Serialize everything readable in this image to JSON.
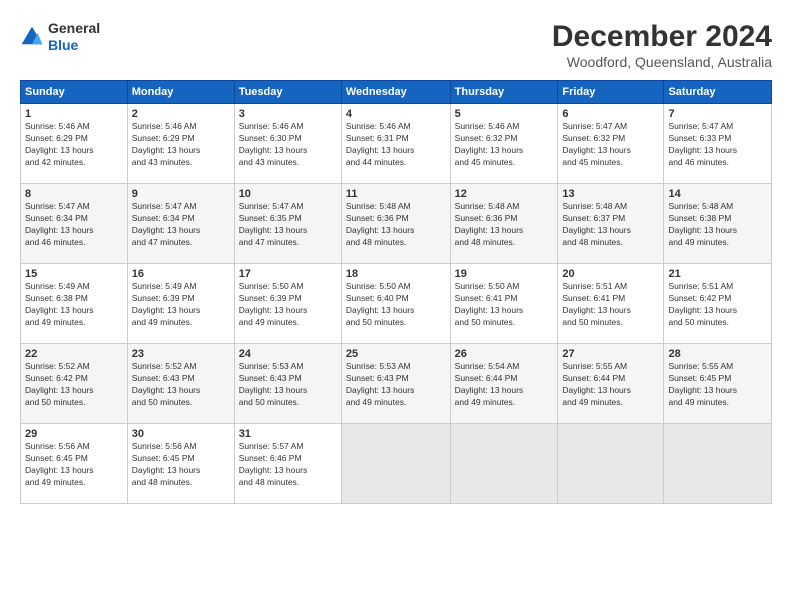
{
  "header": {
    "logo": {
      "line1": "General",
      "line2": "Blue"
    },
    "title": "December 2024",
    "subtitle": "Woodford, Queensland, Australia"
  },
  "calendar": {
    "days_of_week": [
      "Sunday",
      "Monday",
      "Tuesday",
      "Wednesday",
      "Thursday",
      "Friday",
      "Saturday"
    ],
    "weeks": [
      [
        null,
        null,
        null,
        null,
        null,
        null,
        null
      ]
    ],
    "cells": [
      {
        "day": null,
        "info": ""
      },
      {
        "day": null,
        "info": ""
      },
      {
        "day": null,
        "info": ""
      },
      {
        "day": null,
        "info": ""
      },
      {
        "day": null,
        "info": ""
      },
      {
        "day": null,
        "info": ""
      },
      {
        "day": null,
        "info": ""
      }
    ],
    "rows": [
      [
        {
          "day": 1,
          "sunrise": "5:46 AM",
          "sunset": "6:29 PM",
          "daylight": "13 hours and 42 minutes."
        },
        {
          "day": 2,
          "sunrise": "5:46 AM",
          "sunset": "6:29 PM",
          "daylight": "13 hours and 43 minutes."
        },
        {
          "day": 3,
          "sunrise": "5:46 AM",
          "sunset": "6:30 PM",
          "daylight": "13 hours and 43 minutes."
        },
        {
          "day": 4,
          "sunrise": "5:46 AM",
          "sunset": "6:31 PM",
          "daylight": "13 hours and 44 minutes."
        },
        {
          "day": 5,
          "sunrise": "5:46 AM",
          "sunset": "6:32 PM",
          "daylight": "13 hours and 45 minutes."
        },
        {
          "day": 6,
          "sunrise": "5:47 AM",
          "sunset": "6:32 PM",
          "daylight": "13 hours and 45 minutes."
        },
        {
          "day": 7,
          "sunrise": "5:47 AM",
          "sunset": "6:33 PM",
          "daylight": "13 hours and 46 minutes."
        }
      ],
      [
        {
          "day": 8,
          "sunrise": "5:47 AM",
          "sunset": "6:34 PM",
          "daylight": "13 hours and 46 minutes."
        },
        {
          "day": 9,
          "sunrise": "5:47 AM",
          "sunset": "6:34 PM",
          "daylight": "13 hours and 47 minutes."
        },
        {
          "day": 10,
          "sunrise": "5:47 AM",
          "sunset": "6:35 PM",
          "daylight": "13 hours and 47 minutes."
        },
        {
          "day": 11,
          "sunrise": "5:48 AM",
          "sunset": "6:36 PM",
          "daylight": "13 hours and 48 minutes."
        },
        {
          "day": 12,
          "sunrise": "5:48 AM",
          "sunset": "6:36 PM",
          "daylight": "13 hours and 48 minutes."
        },
        {
          "day": 13,
          "sunrise": "5:48 AM",
          "sunset": "6:37 PM",
          "daylight": "13 hours and 48 minutes."
        },
        {
          "day": 14,
          "sunrise": "5:48 AM",
          "sunset": "6:38 PM",
          "daylight": "13 hours and 49 minutes."
        }
      ],
      [
        {
          "day": 15,
          "sunrise": "5:49 AM",
          "sunset": "6:38 PM",
          "daylight": "13 hours and 49 minutes."
        },
        {
          "day": 16,
          "sunrise": "5:49 AM",
          "sunset": "6:39 PM",
          "daylight": "13 hours and 49 minutes."
        },
        {
          "day": 17,
          "sunrise": "5:50 AM",
          "sunset": "6:39 PM",
          "daylight": "13 hours and 49 minutes."
        },
        {
          "day": 18,
          "sunrise": "5:50 AM",
          "sunset": "6:40 PM",
          "daylight": "13 hours and 50 minutes."
        },
        {
          "day": 19,
          "sunrise": "5:50 AM",
          "sunset": "6:41 PM",
          "daylight": "13 hours and 50 minutes."
        },
        {
          "day": 20,
          "sunrise": "5:51 AM",
          "sunset": "6:41 PM",
          "daylight": "13 hours and 50 minutes."
        },
        {
          "day": 21,
          "sunrise": "5:51 AM",
          "sunset": "6:42 PM",
          "daylight": "13 hours and 50 minutes."
        }
      ],
      [
        {
          "day": 22,
          "sunrise": "5:52 AM",
          "sunset": "6:42 PM",
          "daylight": "13 hours and 50 minutes."
        },
        {
          "day": 23,
          "sunrise": "5:52 AM",
          "sunset": "6:43 PM",
          "daylight": "13 hours and 50 minutes."
        },
        {
          "day": 24,
          "sunrise": "5:53 AM",
          "sunset": "6:43 PM",
          "daylight": "13 hours and 50 minutes."
        },
        {
          "day": 25,
          "sunrise": "5:53 AM",
          "sunset": "6:43 PM",
          "daylight": "13 hours and 49 minutes."
        },
        {
          "day": 26,
          "sunrise": "5:54 AM",
          "sunset": "6:44 PM",
          "daylight": "13 hours and 49 minutes."
        },
        {
          "day": 27,
          "sunrise": "5:55 AM",
          "sunset": "6:44 PM",
          "daylight": "13 hours and 49 minutes."
        },
        {
          "day": 28,
          "sunrise": "5:55 AM",
          "sunset": "6:45 PM",
          "daylight": "13 hours and 49 minutes."
        }
      ],
      [
        {
          "day": 29,
          "sunrise": "5:56 AM",
          "sunset": "6:45 PM",
          "daylight": "13 hours and 49 minutes."
        },
        {
          "day": 30,
          "sunrise": "5:56 AM",
          "sunset": "6:45 PM",
          "daylight": "13 hours and 48 minutes."
        },
        {
          "day": 31,
          "sunrise": "5:57 AM",
          "sunset": "6:46 PM",
          "daylight": "13 hours and 48 minutes."
        },
        null,
        null,
        null,
        null
      ]
    ]
  }
}
